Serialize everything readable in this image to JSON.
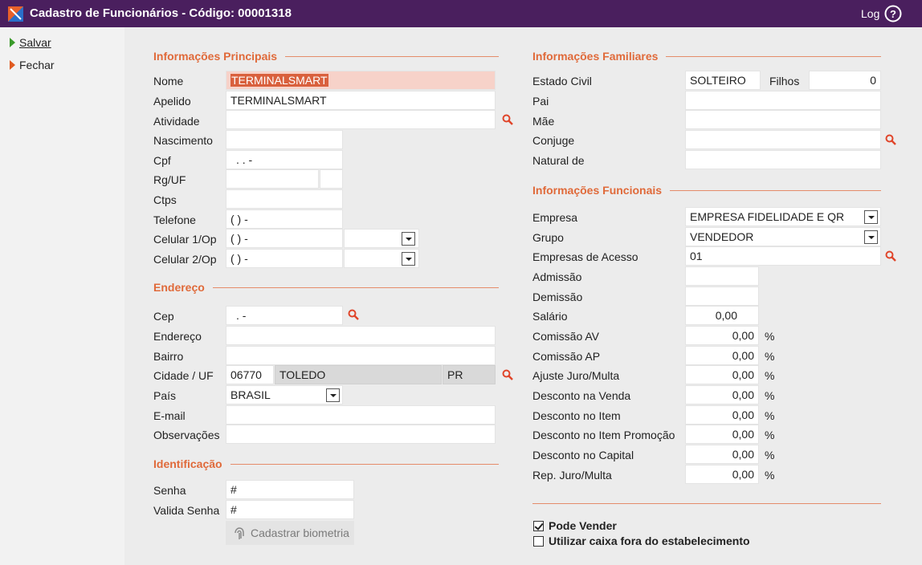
{
  "window": {
    "title": "Cadastro de Funcionários - Código: 00001318",
    "log_label": "Log"
  },
  "sidebar": {
    "save_label": "Salvar",
    "close_label": "Fechar"
  },
  "colors": {
    "titlebar": "#4a1f5e",
    "accent": "#e06a3a",
    "save_arrow": "#3a9a2a",
    "close_arrow": "#e05a20"
  },
  "principais": {
    "section_title": "Informações Principais",
    "nome": {
      "label": "Nome",
      "value": "TERMINALSMART"
    },
    "apelido": {
      "label": "Apelido",
      "value": "TERMINALSMART"
    },
    "atividade": {
      "label": "Atividade",
      "value": ""
    },
    "nascimento": {
      "label": "Nascimento",
      "value": ""
    },
    "cpf": {
      "label": "Cpf",
      "value": ". . -"
    },
    "rg": {
      "label": "Rg/UF",
      "value": ""
    },
    "ctps": {
      "label": "Ctps",
      "value": ""
    },
    "telefone": {
      "label": "Telefone",
      "value": "( ) -"
    },
    "celular1": {
      "label": "Celular 1/Op",
      "value": "( ) -"
    },
    "celular2": {
      "label": "Celular 2/Op",
      "value": "( ) -"
    }
  },
  "endereco": {
    "section_title": "Endereço",
    "cep": {
      "label": "Cep",
      "value": ". -"
    },
    "endereco": {
      "label": "Endereço",
      "value": ""
    },
    "bairro": {
      "label": "Bairro",
      "value": ""
    },
    "cidade": {
      "label": "Cidade / UF",
      "code": "06770",
      "name": "TOLEDO",
      "uf": "PR"
    },
    "pais": {
      "label": "País",
      "value": "BRASIL"
    },
    "email": {
      "label": "E-mail",
      "value": ""
    },
    "observacoes": {
      "label": "Observações",
      "value": ""
    }
  },
  "identificacao": {
    "section_title": "Identificação",
    "senha": {
      "label": "Senha",
      "value": "#"
    },
    "valida_senha": {
      "label": "Valida Senha",
      "value": "#"
    },
    "biometria_label": "Cadastrar biometria"
  },
  "familiares": {
    "section_title": "Informações Familiares",
    "estado_civil": {
      "label": "Estado Civil",
      "value": "SOLTEIRO"
    },
    "filhos": {
      "label": "Filhos",
      "value": "0"
    },
    "pai": {
      "label": "Pai",
      "value": ""
    },
    "mae": {
      "label": "Mãe",
      "value": ""
    },
    "conjuge": {
      "label": "Conjuge",
      "value": ""
    },
    "natural": {
      "label": "Natural de",
      "value": ""
    }
  },
  "funcionais": {
    "section_title": "Informações Funcionais",
    "empresa": {
      "label": "Empresa",
      "value": "EMPRESA FIDELIDADE E QR"
    },
    "grupo": {
      "label": "Grupo",
      "value": "VENDEDOR"
    },
    "empresas_acesso": {
      "label": "Empresas de Acesso",
      "value": "01"
    },
    "admissao": {
      "label": "Admissão",
      "value": ""
    },
    "demissao": {
      "label": "Demissão",
      "value": ""
    },
    "salario": {
      "label": "Salário",
      "value": "0,00"
    },
    "percent_sign": "%",
    "percent_rows": [
      {
        "label": "Comissão AV",
        "value": "0,00"
      },
      {
        "label": "Comissão AP",
        "value": "0,00"
      },
      {
        "label": "Ajuste Juro/Multa",
        "value": "0,00"
      },
      {
        "label": "Desconto na Venda",
        "value": "0,00"
      },
      {
        "label": "Desconto no Item",
        "value": "0,00"
      },
      {
        "label": "Desconto no Item Promoção",
        "value": "0,00"
      },
      {
        "label": "Desconto no Capital",
        "value": "0,00"
      },
      {
        "label": "Rep. Juro/Multa",
        "value": "0,00"
      }
    ]
  },
  "options": {
    "pode_vender": {
      "label": "Pode Vender",
      "checked": true
    },
    "caixa_fora": {
      "label": "Utilizar caixa fora do estabelecimento",
      "checked": false
    }
  }
}
